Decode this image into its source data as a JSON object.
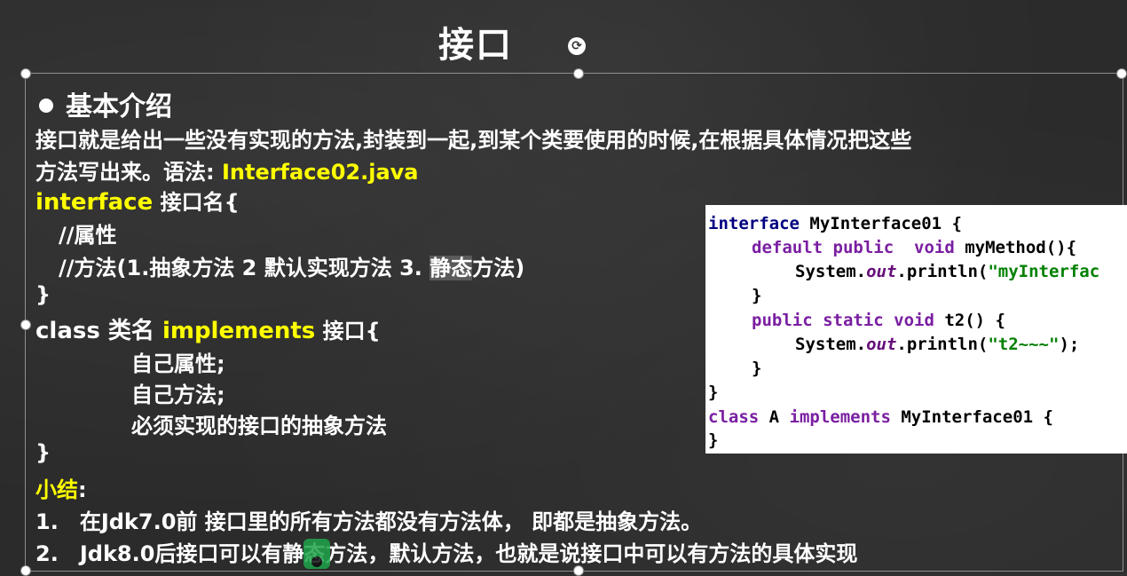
{
  "slide": {
    "title": "接口",
    "section_heading": "基本介绍",
    "intro_line1": "接口就是给出一些没有实现的方法,封装到一起,到某个类要使用的时候,在根据具体情况把这些",
    "intro_line2_a": "方法写出来。语法: ",
    "intro_line2_b": "Interface02.java",
    "syntax": {
      "interface_kw": "interface",
      "interface_rest": " 接口名{",
      "comment_attr": "//属性",
      "comment_methods_a": "//方法(1.抽象方法 2 默认实现方法 3. ",
      "comment_methods_hl": "静态",
      "comment_methods_b": "方法)",
      "close1": "}",
      "class_a": "class 类名 ",
      "class_kw": "implements",
      "class_b": " 接口{",
      "own_attr": "自己属性;",
      "own_method": "自己方法;",
      "must_impl": "必须实现的接口的抽象方法",
      "close2": "}"
    },
    "summary": {
      "heading": "小结",
      "colon": ":",
      "items": [
        {
          "num": "1.",
          "text": "在Jdk7.0前 接口里的所有方法都没有方法体， 即都是抽象方法。"
        },
        {
          "num": "2.",
          "text": "Jdk8.0后接口可以有静态方法，默认方法，也就是说接口中可以有方法的具体实现"
        }
      ]
    }
  },
  "code": {
    "l1_kw": "interface",
    "l1_rest": " MyInterface01 {",
    "l2_kw": "default public  void",
    "l2_rest": " myMethod(){",
    "l3_a": "System.",
    "l3_field": "out",
    "l3_b": ".println(",
    "l3_str": "\"myInterfac",
    "l4": "}",
    "l5_kw": "public static void",
    "l5_rest": " t2() {",
    "l6_a": "System.",
    "l6_field": "out",
    "l6_b": ".println(",
    "l6_str": "\"t2~~~\"",
    "l6_c": ");",
    "l7": "}",
    "l8": "}",
    "l9_kw1": "class",
    "l9_mid": " A ",
    "l9_kw2": "implements",
    "l9_rest": " MyInterface01 {",
    "l10": "}"
  }
}
